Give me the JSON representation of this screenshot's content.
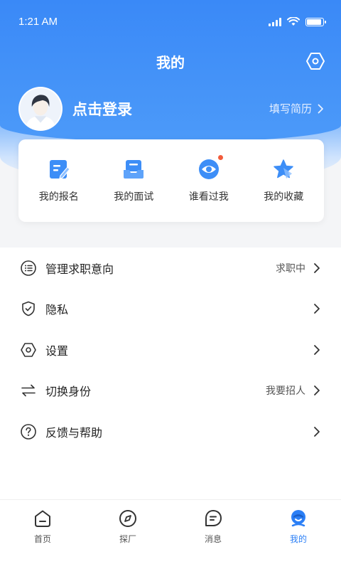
{
  "status": {
    "time": "1:21 AM"
  },
  "header": {
    "title": "我的",
    "settings_icon": "settings-hexagon-icon"
  },
  "profile": {
    "login_text": "点击登录",
    "resume_link": "填写简历"
  },
  "quick_actions": [
    {
      "label": "我的报名",
      "icon": "edit-document-icon"
    },
    {
      "label": "我的面试",
      "icon": "inbox-icon"
    },
    {
      "label": "谁看过我",
      "icon": "eye-icon",
      "badge": true
    },
    {
      "label": "我的收藏",
      "icon": "star-icon"
    }
  ],
  "menu": [
    {
      "label": "管理求职意向",
      "value": "求职中",
      "icon": "list-circle-icon"
    },
    {
      "label": "隐私",
      "value": "",
      "icon": "shield-check-icon"
    },
    {
      "label": "设置",
      "value": "",
      "icon": "settings-hexagon-icon"
    },
    {
      "label": "切换身份",
      "value": "我要招人",
      "icon": "swap-arrows-icon"
    },
    {
      "label": "反馈与帮助",
      "value": "",
      "icon": "help-circle-icon"
    }
  ],
  "tabs": [
    {
      "label": "首页",
      "icon": "home-icon"
    },
    {
      "label": "探厂",
      "icon": "compass-icon"
    },
    {
      "label": "消息",
      "icon": "message-icon"
    },
    {
      "label": "我的",
      "icon": "user-face-icon",
      "active": true
    }
  ],
  "colors": {
    "primary": "#2b7ff6",
    "header_blue": "#3a89f7",
    "badge_red": "#f25b3b"
  }
}
